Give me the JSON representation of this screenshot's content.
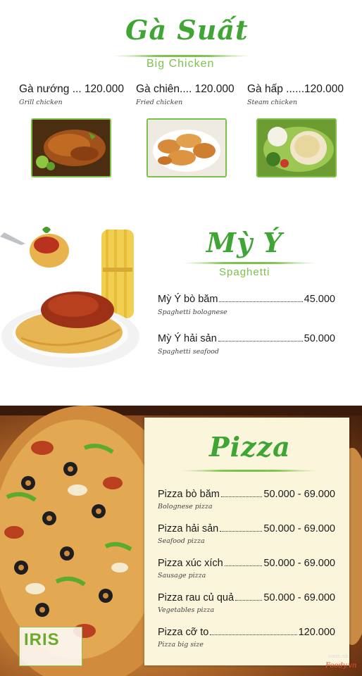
{
  "chicken": {
    "title": "Gà Suất",
    "subtitle": "Big Chicken",
    "items": [
      {
        "name": "Gà nướng",
        "dots": "...",
        "price": "120.000",
        "english": "Grill chicken"
      },
      {
        "name": "Gà chiên",
        "dots": "....",
        "price": "120.000",
        "english": "Fried chicken"
      },
      {
        "name": "Gà hấp",
        "dots": "......",
        "price": "120.000",
        "english": "Steam chicken"
      }
    ]
  },
  "spaghetti": {
    "title": "Mỳ Ý",
    "subtitle": "Spaghetti",
    "items": [
      {
        "name": "Mỳ Ý bò băm",
        "price": "45.000",
        "english": "Spaghetti bolognese"
      },
      {
        "name": "Mỳ Ý hải sản",
        "price": "50.000",
        "english": "Spaghetti seafood"
      }
    ]
  },
  "pizza": {
    "title": "Pizza",
    "items": [
      {
        "name": "Pizza bò băm",
        "price": "50.000 - 69.000",
        "english": "Bolognese pizza"
      },
      {
        "name": "Pizza hải sản",
        "price": "50.000 - 69.000",
        "english": "Seafood pizza"
      },
      {
        "name": "Pizza xúc xích",
        "price": "50.000 - 69.000",
        "english": "Sausage pizza"
      },
      {
        "name": "Pizza rau củ quả",
        "price": "50.000 - 69.000",
        "english": "Vegetables pizza"
      },
      {
        "name": "Pizza cỡ to",
        "price": "120.000",
        "english": "Pizza big size"
      }
    ]
  },
  "branding": {
    "logo": "IRIS",
    "watermark_site": "Foody.vn",
    "watermark_user": "oanh.nk"
  },
  "colors": {
    "accent_green": "#3fa535",
    "light_green": "#7cc24a",
    "panel_cream": "#fbf5dc"
  }
}
